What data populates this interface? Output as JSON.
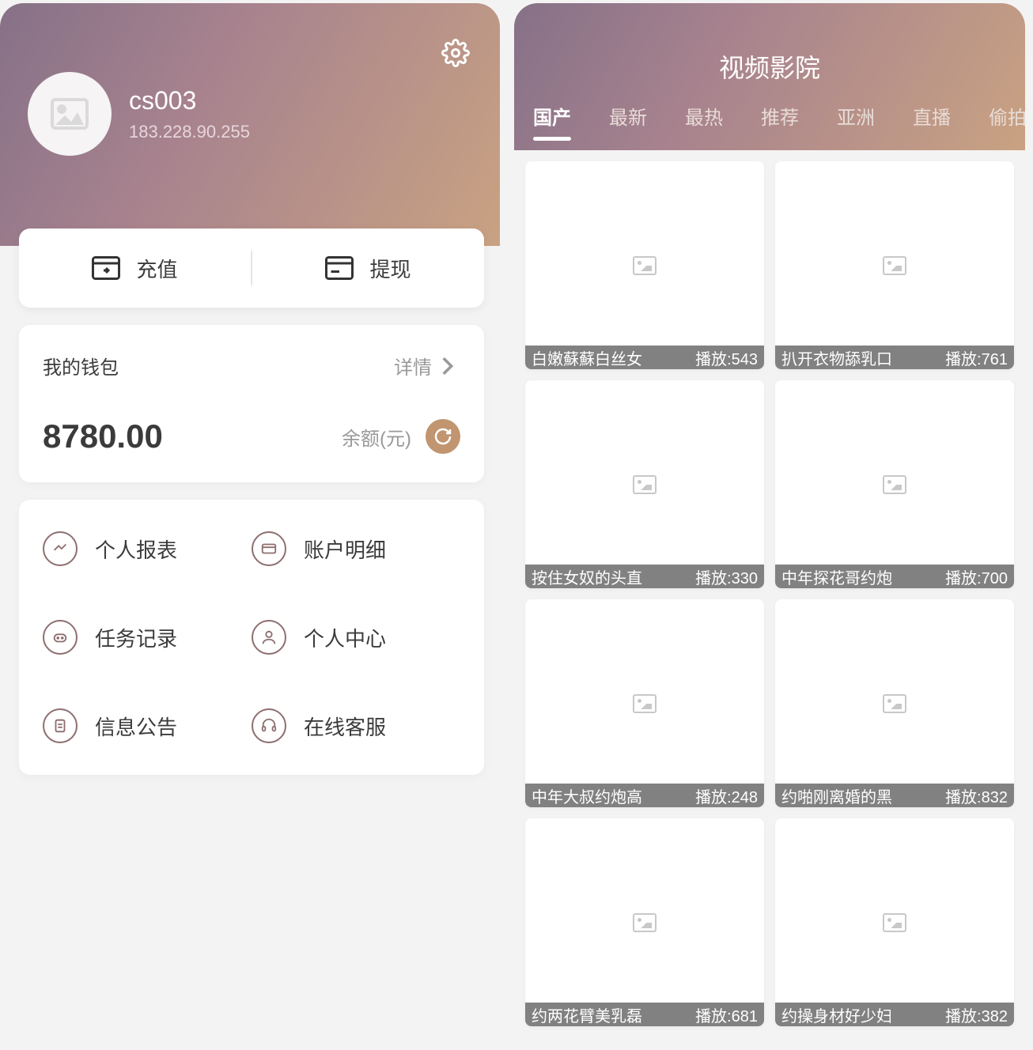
{
  "user": {
    "name": "cs003",
    "ip": "183.228.90.255"
  },
  "actions": {
    "deposit": "充值",
    "withdraw": "提现"
  },
  "wallet": {
    "title": "我的钱包",
    "detail": "详情",
    "balance": "8780.00",
    "balance_label": "余额(元)"
  },
  "menu": {
    "report": "个人报表",
    "account": "账户明细",
    "tasks": "任务记录",
    "profile": "个人中心",
    "notice": "信息公告",
    "service": "在线客服"
  },
  "video": {
    "title": "视频影院",
    "tabs": [
      "国产",
      "最新",
      "最热",
      "推荐",
      "亚洲",
      "直播",
      "偷拍"
    ],
    "play_prefix": "播放:",
    "items": [
      {
        "name": "白嫩蘇蘇白丝女",
        "plays": "543"
      },
      {
        "name": "扒开衣物舔乳口",
        "plays": "761"
      },
      {
        "name": "按住女奴的头直",
        "plays": "330"
      },
      {
        "name": "中年探花哥约炮",
        "plays": "700"
      },
      {
        "name": "中年大叔约炮高",
        "plays": "248"
      },
      {
        "name": "约啪刚离婚的黑",
        "plays": "832"
      },
      {
        "name": "约两花臂美乳磊",
        "plays": "681"
      },
      {
        "name": "约操身材好少妇",
        "plays": "382"
      }
    ]
  }
}
